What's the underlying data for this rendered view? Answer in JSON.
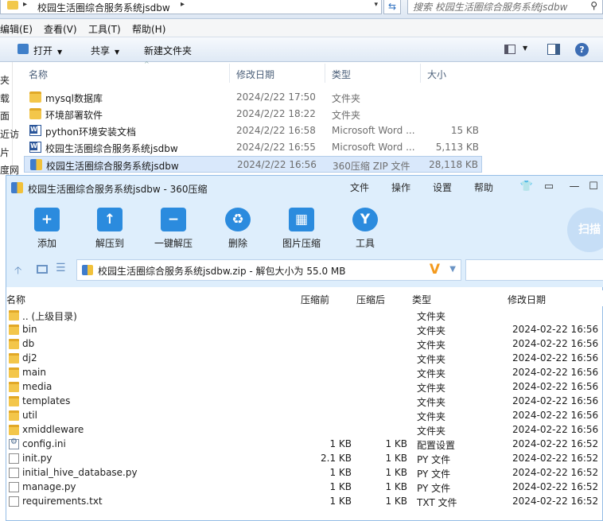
{
  "explorer": {
    "address_path": "校园生活圈综合服务系统jsdbw",
    "search_placeholder": "搜索 校园生活圈综合服务系统jsdbw",
    "menu": [
      "编辑(E)",
      "查看(V)",
      "工具(T)",
      "帮助(H)"
    ],
    "toolbar": {
      "open": "打开",
      "share": "共享",
      "new_folder": "新建文件夹"
    },
    "nav_fragments": [
      "夹",
      "载",
      "面",
      "近访",
      "片",
      "度网"
    ],
    "columns": {
      "name": "名称",
      "date": "修改日期",
      "type": "类型",
      "size": "大小"
    },
    "files": [
      {
        "name": "mysql数据库",
        "date": "2024/2/22 17:50",
        "type": "文件夹",
        "size": "",
        "icon": "folder-icon"
      },
      {
        "name": "环境部署软件",
        "date": "2024/2/22 18:22",
        "type": "文件夹",
        "size": "",
        "icon": "folder-icon"
      },
      {
        "name": "python环境安装文档",
        "date": "2024/2/22 16:58",
        "type": "Microsoft Word ...",
        "size": "15 KB",
        "icon": "word-doc-icon"
      },
      {
        "name": "校园生活圈综合服务系统jsdbw",
        "date": "2024/2/22 16:55",
        "type": "Microsoft Word ...",
        "size": "5,113 KB",
        "icon": "word-doc-icon"
      },
      {
        "name": "校园生活圈综合服务系统jsdbw",
        "date": "2024/2/22 16:56",
        "type": "360压缩 ZIP 文件",
        "size": "28,118 KB",
        "icon": "zip-archive-icon",
        "selected": true
      }
    ]
  },
  "zip": {
    "title": "校园生活圈综合服务系统jsdbw - 360压缩",
    "menu": {
      "file": "文件",
      "operate": "操作",
      "settings": "设置",
      "help": "帮助"
    },
    "tools": [
      {
        "label": "添加",
        "icon": "add-icon"
      },
      {
        "label": "解压到",
        "icon": "extract-to-icon"
      },
      {
        "label": "一键解压",
        "icon": "one-click-extract-icon"
      },
      {
        "label": "删除",
        "icon": "delete-icon"
      },
      {
        "label": "图片压缩",
        "icon": "image-compress-icon"
      },
      {
        "label": "工具",
        "icon": "tools-icon"
      }
    ],
    "scan_label": "扫描",
    "path": "校园生活圈综合服务系统jsdbw.zip - 解包大小为 55.0 MB",
    "columns": {
      "name": "名称",
      "compressed_before": "压缩前",
      "compressed_after": "压缩后",
      "type": "类型",
      "modified": "修改日期"
    },
    "rows": [
      {
        "name": ".. (上级目录)",
        "before": "",
        "after": "",
        "type": "文件夹",
        "date": "",
        "icon": "folder"
      },
      {
        "name": "bin",
        "before": "",
        "after": "",
        "type": "文件夹",
        "date": "2024-02-22 16:56",
        "icon": "folder"
      },
      {
        "name": "db",
        "before": "",
        "after": "",
        "type": "文件夹",
        "date": "2024-02-22 16:56",
        "icon": "folder"
      },
      {
        "name": "dj2",
        "before": "",
        "after": "",
        "type": "文件夹",
        "date": "2024-02-22 16:56",
        "icon": "folder"
      },
      {
        "name": "main",
        "before": "",
        "after": "",
        "type": "文件夹",
        "date": "2024-02-22 16:56",
        "icon": "folder"
      },
      {
        "name": "media",
        "before": "",
        "after": "",
        "type": "文件夹",
        "date": "2024-02-22 16:56",
        "icon": "folder"
      },
      {
        "name": "templates",
        "before": "",
        "after": "",
        "type": "文件夹",
        "date": "2024-02-22 16:56",
        "icon": "folder"
      },
      {
        "name": "util",
        "before": "",
        "after": "",
        "type": "文件夹",
        "date": "2024-02-22 16:56",
        "icon": "folder"
      },
      {
        "name": "xmiddleware",
        "before": "",
        "after": "",
        "type": "文件夹",
        "date": "2024-02-22 16:56",
        "icon": "folder"
      },
      {
        "name": "config.ini",
        "before": "1 KB",
        "after": "1 KB",
        "type": "配置设置",
        "date": "2024-02-22 16:52",
        "icon": "cfg"
      },
      {
        "name": "init.py",
        "before": "2.1 KB",
        "after": "1 KB",
        "type": "PY 文件",
        "date": "2024-02-22 16:52",
        "icon": "file"
      },
      {
        "name": "initial_hive_database.py",
        "before": "1 KB",
        "after": "1 KB",
        "type": "PY 文件",
        "date": "2024-02-22 16:52",
        "icon": "file"
      },
      {
        "name": "manage.py",
        "before": "1 KB",
        "after": "1 KB",
        "type": "PY 文件",
        "date": "2024-02-22 16:52",
        "icon": "file"
      },
      {
        "name": "requirements.txt",
        "before": "1 KB",
        "after": "1 KB",
        "type": "TXT 文件",
        "date": "2024-02-22 16:52",
        "icon": "file"
      }
    ]
  }
}
